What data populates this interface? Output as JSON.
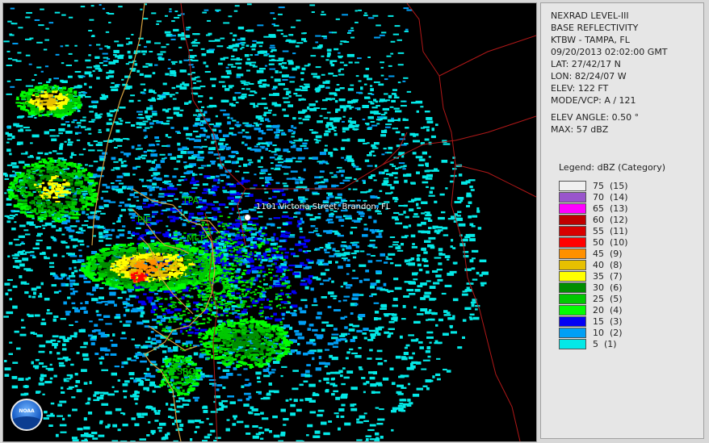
{
  "info": {
    "line1": "NEXRAD LEVEL-III",
    "line2": "BASE REFLECTIVITY",
    "line3": "KTBW - TAMPA, FL",
    "line4": "09/20/2013 02:02:00 GMT",
    "line5": "LAT: 27/42/17 N",
    "line6": "LON: 82/24/07 W",
    "line7": "ELEV: 122 FT",
    "line8": "MODE/VCP: A / 121",
    "line9": "ELEV ANGLE: 0.50 °",
    "line10": "MAX: 57 dBZ"
  },
  "legend": {
    "title": "Legend: dBZ (Category)",
    "items": [
      {
        "label": "75  (15)",
        "color": "#f0f0f0"
      },
      {
        "label": "70  (14)",
        "color": "#9955cc"
      },
      {
        "label": "65  (13)",
        "color": "#ff00ff"
      },
      {
        "label": "60  (12)",
        "color": "#c00000"
      },
      {
        "label": "55  (11)",
        "color": "#d80000"
      },
      {
        "label": "50  (10)",
        "color": "#ff0000"
      },
      {
        "label": "45  (9)",
        "color": "#ff9000"
      },
      {
        "label": "40  (8)",
        "color": "#e7c000"
      },
      {
        "label": "35  (7)",
        "color": "#ffff00"
      },
      {
        "label": "30  (6)",
        "color": "#008e00"
      },
      {
        "label": "25  (5)",
        "color": "#01c801"
      },
      {
        "label": "20  (4)",
        "color": "#02fd02"
      },
      {
        "label": "15  (3)",
        "color": "#0300f4"
      },
      {
        "label": "10  (2)",
        "color": "#019ff4"
      },
      {
        "label": "5  (1)",
        "color": "#04e9e7"
      }
    ]
  },
  "map": {
    "airports": {
      "tpa": "TPA",
      "pie": "PIE",
      "mcf": "MCF",
      "srq": "SRQ"
    },
    "location_label": "1101 Victoria Street, Brandon, FL",
    "logo_text": "NOAA",
    "colors": {
      "county_lines": "#b01818",
      "coast_lines": "#d4a040",
      "marker": "#ffffff"
    }
  }
}
